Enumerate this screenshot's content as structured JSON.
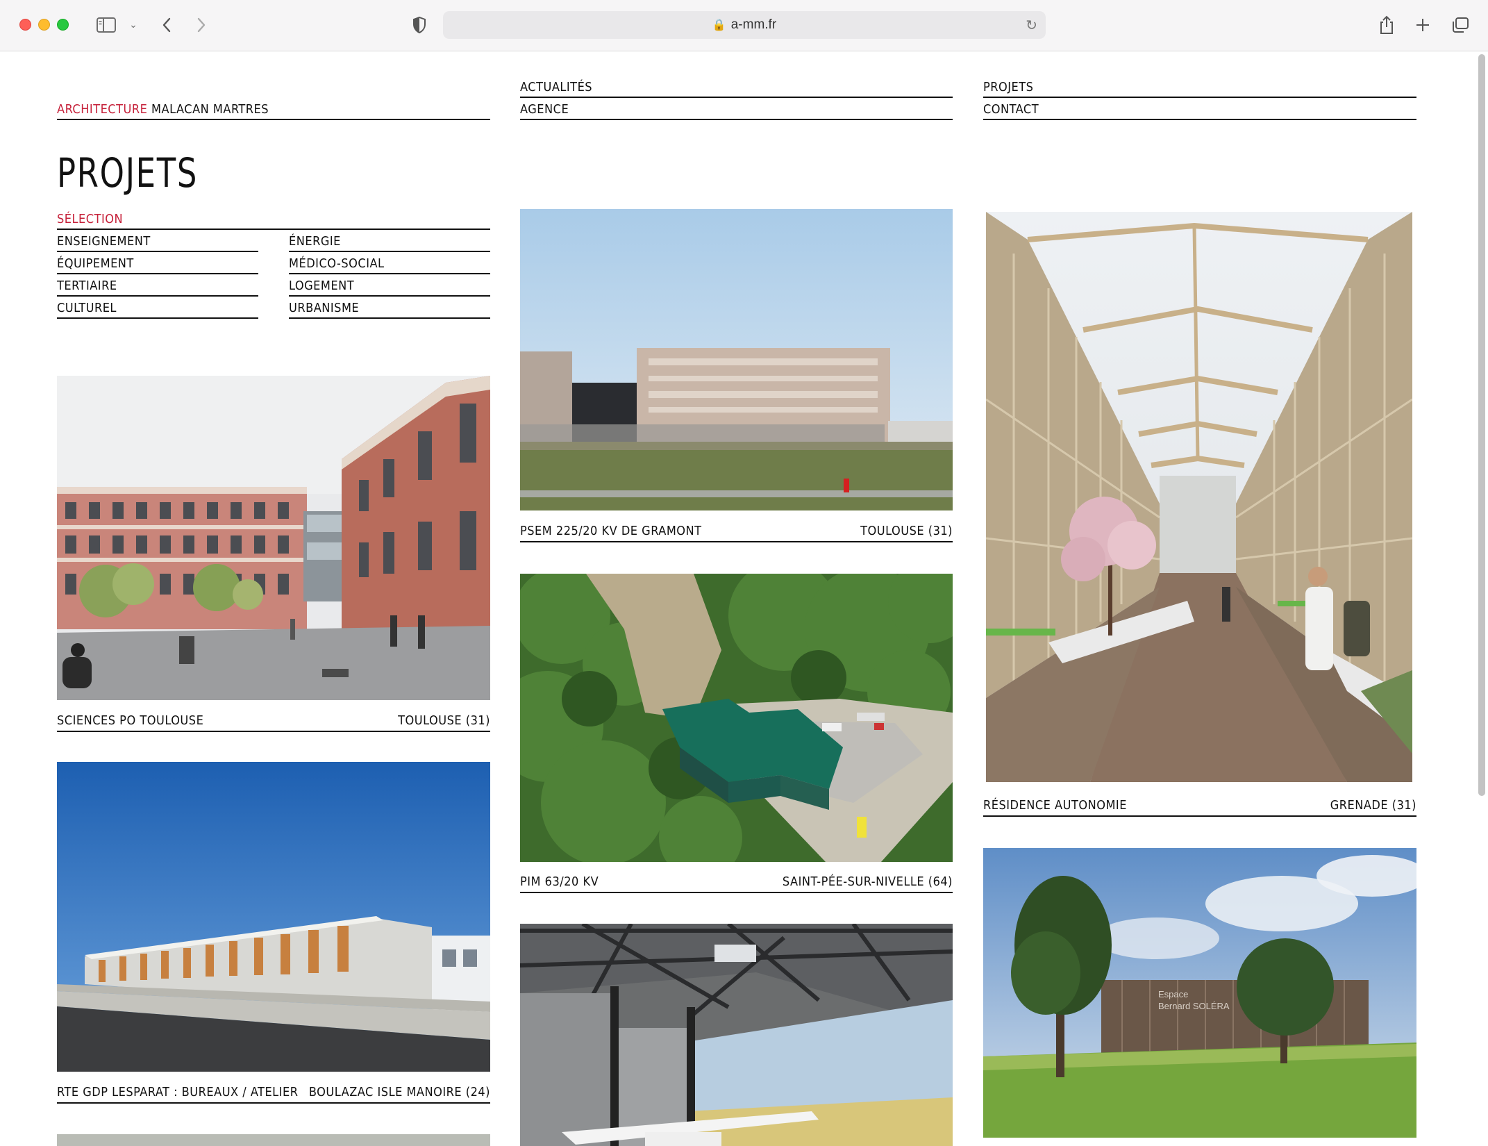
{
  "browser": {
    "url": "a-mm.fr"
  },
  "nav": {
    "brand_highlight": "ARCHITECTURE",
    "brand_rest": "MALACAN MARTRES",
    "actualites": "ACTUALITÉS",
    "agence": "AGENCE",
    "projets": "PROJETS",
    "contact": "CONTACT"
  },
  "page": {
    "title": "PROJETS"
  },
  "categories": {
    "selection": "SÉLECTION",
    "left": [
      "ENSEIGNEMENT",
      "ÉQUIPEMENT",
      "TERTIAIRE",
      "CULTUREL"
    ],
    "right": [
      "ÉNERGIE",
      "MÉDICO-SOCIAL",
      "LOGEMENT",
      "URBANISME"
    ]
  },
  "projects": [
    {
      "name": "SCIENCES PO TOULOUSE",
      "location": "TOULOUSE (31)"
    },
    {
      "name": "RTE GDP LESPARAT : BUREAUX / ATELIER",
      "location": "BOULAZAC ISLE MANOIRE (24)"
    },
    {
      "name": "PSEM 225/20 KV DE GRAMONT",
      "location": "TOULOUSE (31)"
    },
    {
      "name": "PIM 63/20 KV",
      "location": "SAINT-PÉE-SUR-NIVELLE (64)"
    },
    {
      "name": "RÉSIDENCE AUTONOMIE",
      "location": "GRENADE (31)"
    }
  ],
  "images": {
    "solera_sign_line1": "Espace",
    "solera_sign_line2": "Bernard SOLÉRA"
  },
  "colors": {
    "accent": "#c6213a",
    "text": "#111111"
  }
}
